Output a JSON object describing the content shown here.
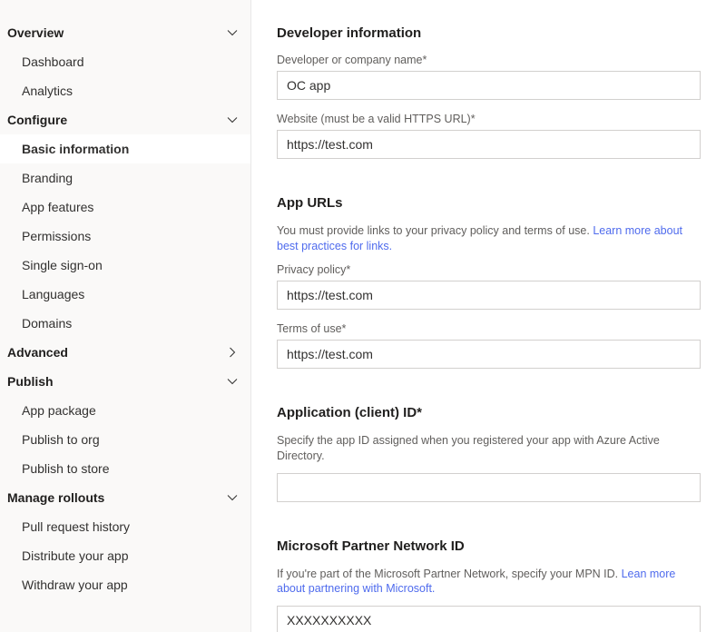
{
  "sidebar": {
    "overview": {
      "label": "Overview",
      "items": [
        "Dashboard",
        "Analytics"
      ]
    },
    "configure": {
      "label": "Configure",
      "items": [
        "Basic information",
        "Branding",
        "App features",
        "Permissions",
        "Single sign-on",
        "Languages",
        "Domains"
      ]
    },
    "advanced": {
      "label": "Advanced"
    },
    "publish": {
      "label": "Publish",
      "items": [
        "App package",
        "Publish to org",
        "Publish to store"
      ]
    },
    "manage": {
      "label": "Manage rollouts",
      "items": [
        "Pull request history",
        "Distribute your app",
        "Withdraw your app"
      ]
    }
  },
  "main": {
    "devinfo": {
      "title": "Developer information",
      "name_label": "Developer or company name*",
      "name_value": "OC app",
      "website_label": "Website (must be a valid HTTPS URL)*",
      "website_value": "https://test.com"
    },
    "appurls": {
      "title": "App URLs",
      "desc_prefix": "You must provide links to your privacy policy and terms of use. ",
      "desc_link": "Learn more about best practices for links.",
      "privacy_label": "Privacy policy*",
      "privacy_value": "https://test.com",
      "terms_label": "Terms of use*",
      "terms_value": "https://test.com"
    },
    "clientid": {
      "title": "Application (client) ID*",
      "desc": "Specify the app ID assigned when you registered your app with Azure Active Directory.",
      "value": ""
    },
    "mpn": {
      "title": "Microsoft Partner Network ID",
      "desc_prefix": "If you're part of the Microsoft Partner Network, specify your MPN ID. ",
      "desc_link": "Lean more about partnering with Microsoft.",
      "value": "XXXXXXXXXX"
    }
  }
}
